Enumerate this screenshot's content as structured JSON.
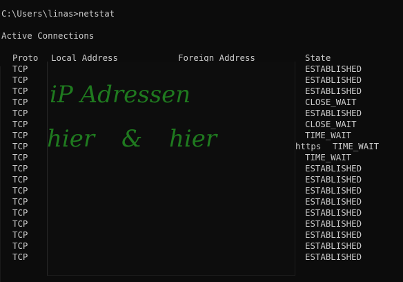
{
  "prompt": {
    "path": "C:\\Users\\linas>",
    "command": "netstat"
  },
  "section_title": "Active Connections",
  "table": {
    "headers": {
      "proto": "Proto",
      "local": "Local Address",
      "foreign": "Foreign Address",
      "state": "State"
    },
    "rows": [
      {
        "proto": "TCP",
        "foreign_tail": "",
        "state": "ESTABLISHED"
      },
      {
        "proto": "TCP",
        "foreign_tail": "",
        "state": "ESTABLISHED"
      },
      {
        "proto": "TCP",
        "foreign_tail": "",
        "state": "ESTABLISHED"
      },
      {
        "proto": "TCP",
        "foreign_tail": "",
        "state": "CLOSE_WAIT"
      },
      {
        "proto": "TCP",
        "foreign_tail": "",
        "state": "ESTABLISHED"
      },
      {
        "proto": "TCP",
        "foreign_tail": "",
        "state": "CLOSE_WAIT"
      },
      {
        "proto": "TCP",
        "foreign_tail": "",
        "state": "TIME_WAIT"
      },
      {
        "proto": "TCP",
        "foreign_tail": "https",
        "state": "TIME_WAIT"
      },
      {
        "proto": "TCP",
        "foreign_tail": "",
        "state": "TIME_WAIT"
      },
      {
        "proto": "TCP",
        "foreign_tail": "",
        "state": "ESTABLISHED"
      },
      {
        "proto": "TCP",
        "foreign_tail": "",
        "state": "ESTABLISHED"
      },
      {
        "proto": "TCP",
        "foreign_tail": "",
        "state": "ESTABLISHED"
      },
      {
        "proto": "TCP",
        "foreign_tail": "",
        "state": "ESTABLISHED"
      },
      {
        "proto": "TCP",
        "foreign_tail": "",
        "state": "ESTABLISHED"
      },
      {
        "proto": "TCP",
        "foreign_tail": "",
        "state": "ESTABLISHED"
      },
      {
        "proto": "TCP",
        "foreign_tail": "",
        "state": "ESTABLISHED"
      },
      {
        "proto": "TCP",
        "foreign_tail": "",
        "state": "ESTABLISHED"
      },
      {
        "proto": "TCP",
        "foreign_tail": "",
        "state": "ESTABLISHED"
      }
    ]
  },
  "annotation": {
    "line1": "iP Adressen",
    "line2": "hier & hier",
    "color": "#1f7a1f"
  },
  "colors": {
    "background": "#0c0c0c",
    "text": "#cccccc"
  }
}
